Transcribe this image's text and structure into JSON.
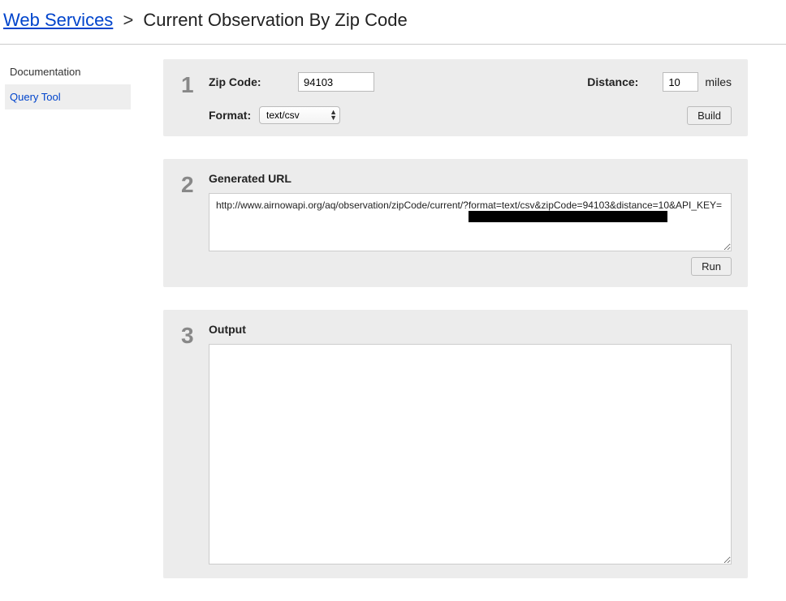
{
  "breadcrumb": {
    "root": "Web Services",
    "separator": ">",
    "current": "Current Observation By Zip Code"
  },
  "sidebar": {
    "items": [
      {
        "label": "Documentation",
        "active": false
      },
      {
        "label": "Query Tool",
        "active": true
      }
    ]
  },
  "step1": {
    "num": "1",
    "zip_label": "Zip Code:",
    "zip_value": "94103",
    "distance_label": "Distance:",
    "distance_value": "10",
    "distance_unit": "miles",
    "format_label": "Format:",
    "format_options": [
      "text/csv"
    ],
    "format_value": "text/csv",
    "build_label": "Build"
  },
  "step2": {
    "num": "2",
    "title": "Generated URL",
    "url_value": "http://www.airnowapi.org/aq/observation/zipCode/current/?format=text/csv&zipCode=94103&distance=10&API_KEY=",
    "run_label": "Run"
  },
  "step3": {
    "num": "3",
    "title": "Output",
    "output_value": ""
  }
}
